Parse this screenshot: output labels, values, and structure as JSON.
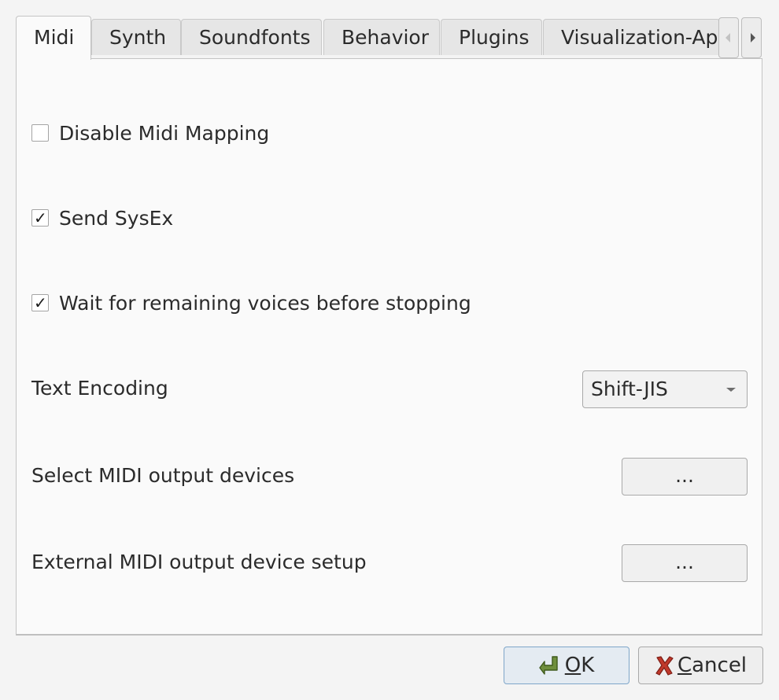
{
  "tabs": [
    {
      "label": "Midi",
      "active": true
    },
    {
      "label": "Synth",
      "active": false
    },
    {
      "label": "Soundfonts",
      "active": false
    },
    {
      "label": "Behavior",
      "active": false
    },
    {
      "label": "Plugins",
      "active": false
    },
    {
      "label": "Visualization-App",
      "active": false
    }
  ],
  "tab_scroll": {
    "left_icon": "chevron-left-icon",
    "right_icon": "chevron-right-icon"
  },
  "midi_page": {
    "disable_midi_mapping": {
      "label": "Disable Midi Mapping",
      "checked": false
    },
    "send_sysex": {
      "label": "Send SysEx",
      "checked": true
    },
    "wait_for_voices": {
      "label": "Wait for remaining voices before stopping",
      "checked": true
    },
    "check_glyph": "✓",
    "text_encoding": {
      "label": "Text Encoding",
      "value": "Shift-JIS"
    },
    "select_output_devices": {
      "label": "Select MIDI output devices",
      "button_label": "..."
    },
    "external_device_setup": {
      "label": "External MIDI output device setup",
      "button_label": "..."
    }
  },
  "dialog_buttons": {
    "ok": {
      "mnemonic": "O",
      "rest": "K",
      "icon": "enter-arrow-icon"
    },
    "cancel": {
      "mnemonic": "C",
      "rest": "ancel",
      "icon": "red-x-icon"
    }
  },
  "colors": {
    "ok_icon": "#6f8f3e",
    "cancel_icon": "#c0392b"
  }
}
